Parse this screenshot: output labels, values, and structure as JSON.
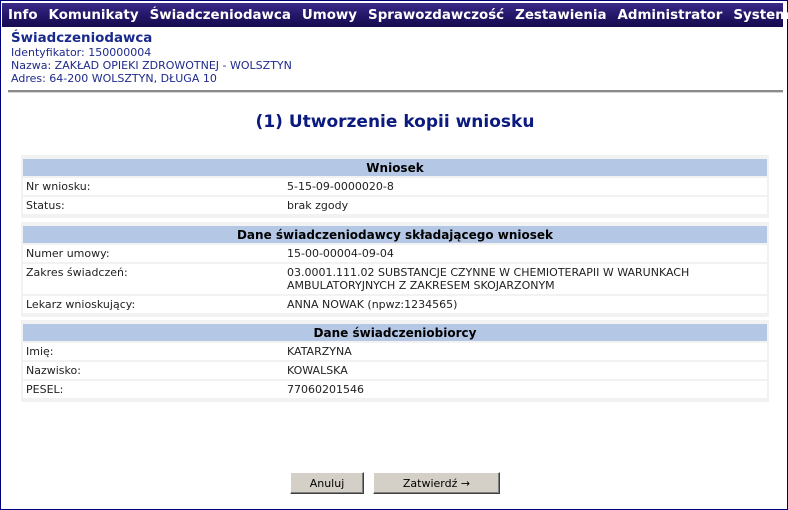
{
  "menu": [
    {
      "label": "Info"
    },
    {
      "label": "Komunikaty"
    },
    {
      "label": "Świadczeniodawca"
    },
    {
      "label": "Umowy"
    },
    {
      "label": "Sprawozdawczość"
    },
    {
      "label": "Zestawienia"
    },
    {
      "label": "Administrator"
    },
    {
      "label": "System"
    }
  ],
  "provider": {
    "title": "Świadczeniodawca",
    "identifier": "Identyfikator: 150000004",
    "name": "Nazwa: ZAKŁAD OPIEKI ZDROWOTNEJ - WOLSZTYN",
    "address": "Adres: 64-200 WOLSZTYN, DŁUGA 10"
  },
  "page_title": "(1) Utworzenie kopii wniosku",
  "sections": {
    "wniosek": {
      "header": "Wniosek",
      "rows": [
        {
          "label": "Nr wniosku:",
          "value": "5-15-09-0000020-8"
        },
        {
          "label": "Status:",
          "value": "brak zgody"
        }
      ]
    },
    "provider_data": {
      "header": "Dane świadczeniodawcy składającego wniosek",
      "rows": [
        {
          "label": "Numer umowy:",
          "value": "15-00-00004-09-04"
        },
        {
          "label": "Zakres świadczeń:",
          "value": "03.0001.111.02 SUBSTANCJE CZYNNE W CHEMIOTERAPII W WARUNKACH AMBULATORYJNYCH Z ZAKRESEM SKOJARZONYM"
        },
        {
          "label": "Lekarz wnioskujący:",
          "value": "ANNA NOWAK (npwz:1234565)"
        }
      ]
    },
    "patient": {
      "header": "Dane świadczeniobiorcy",
      "rows": [
        {
          "label": "Imię:",
          "value": "KATARZYNA"
        },
        {
          "label": "Nazwisko:",
          "value": "KOWALSKA"
        },
        {
          "label": "PESEL:",
          "value": "77060201546"
        }
      ]
    }
  },
  "buttons": {
    "cancel": "Anuluj",
    "confirm": "Zatwierdź →"
  }
}
